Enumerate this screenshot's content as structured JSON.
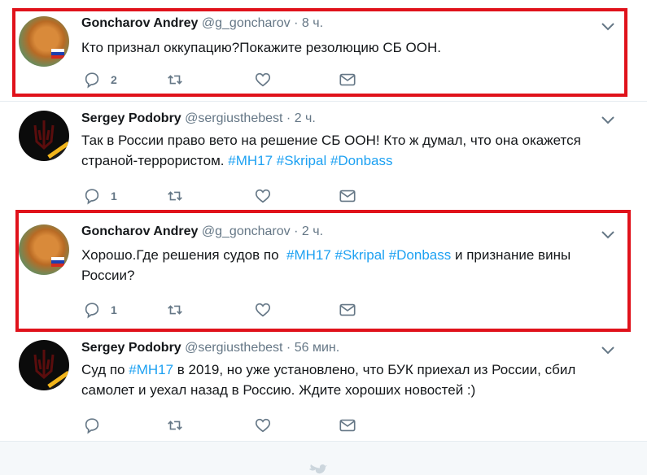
{
  "tweets": [
    {
      "name": "Goncharov Andrey",
      "handle": "@g_goncharov",
      "separator": "·",
      "time": "8 ч.",
      "text": "Кто признал оккупацию?Покажите резолюцию СБ ООН.",
      "reply_count": "2",
      "avatar_icon": "cat-avatar-icon"
    },
    {
      "name": "Sergey Podobry",
      "handle": "@sergiusthebest",
      "separator": "·",
      "time": "2 ч.",
      "text_line1": "Так в России право вето на решение СБ ООН! Кто ж думал, что она окажется",
      "text_line2_prefix": "страной-террористом. ",
      "hashtags": [
        "#MH17",
        "#Skripal",
        "#Donbass"
      ],
      "reply_count": "1",
      "avatar_icon": "trident-avatar-icon"
    },
    {
      "name": "Goncharov Andrey",
      "handle": "@g_goncharov",
      "separator": "·",
      "time": "2 ч.",
      "text_prefix": "Хорошо.Где решения судов по  ",
      "hashtags": [
        "#MH17",
        "#Skripal",
        "#Donbass"
      ],
      "text_suffix": " и признание вины",
      "text_line2": "России?",
      "reply_count": "1",
      "avatar_icon": "cat-avatar-icon"
    },
    {
      "name": "Sergey Podobry",
      "handle": "@sergiusthebest",
      "separator": "·",
      "time": "56 мин.",
      "text_prefix": "Суд по ",
      "hashtag": "#MH17",
      "text_suffix": " в 2019, но уже установлено, что БУК приехал из России, сбил",
      "text_line2": "самолет и уехал назад в Россию. Ждите хороших новостей :)",
      "reply_count": "",
      "avatar_icon": "trident-avatar-icon"
    }
  ],
  "colors": {
    "highlight": "#e0121b",
    "hashtag": "#1da1f2",
    "secondary_text": "#657786",
    "thread_line": "#c4e4f7"
  },
  "icons": [
    "reply-icon",
    "retweet-icon",
    "like-icon",
    "direct-message-icon",
    "chevron-down-icon",
    "twitter-bird-icon"
  ]
}
